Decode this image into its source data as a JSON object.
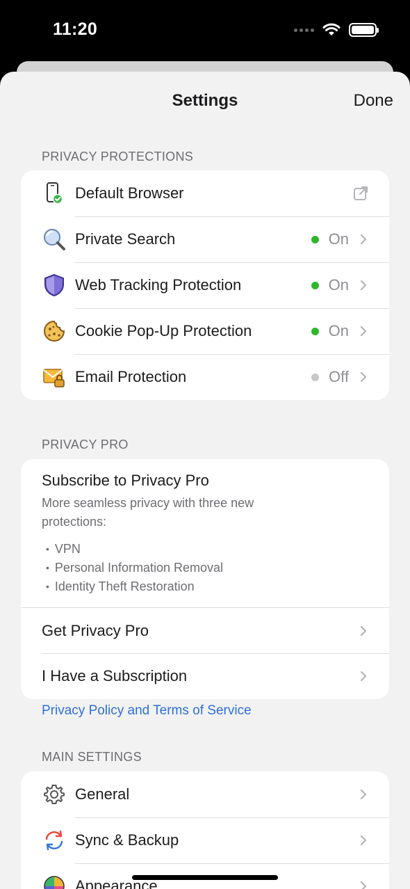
{
  "status_bar": {
    "time": "11:20"
  },
  "nav": {
    "title": "Settings",
    "done": "Done"
  },
  "privacy_protections": {
    "header": "PRIVACY PROTECTIONS",
    "items": [
      {
        "label": "Default Browser",
        "icon": "phone-check-icon"
      },
      {
        "label": "Private Search",
        "status": "On",
        "status_color": "#2fb62c",
        "icon": "magnifier-icon"
      },
      {
        "label": "Web Tracking Protection",
        "status": "On",
        "status_color": "#2fb62c",
        "icon": "shield-icon"
      },
      {
        "label": "Cookie Pop-Up Protection",
        "status": "On",
        "status_color": "#2fb62c",
        "icon": "cookie-icon"
      },
      {
        "label": "Email Protection",
        "status": "Off",
        "status_color": "#c7c7cc",
        "icon": "envelope-lock-icon"
      }
    ]
  },
  "privacy_pro": {
    "header": "PRIVACY PRO",
    "title": "Subscribe to Privacy Pro",
    "description": "More seamless privacy with three new protections:",
    "features": [
      "VPN",
      "Personal Information Removal",
      "Identity Theft Restoration"
    ],
    "get_label": "Get Privacy Pro",
    "have_label": "I Have a Subscription",
    "policy_link": "Privacy Policy and Terms of Service"
  },
  "main_settings": {
    "header": "MAIN SETTINGS",
    "items": [
      {
        "label": "General",
        "icon": "gear-icon"
      },
      {
        "label": "Sync & Backup",
        "icon": "sync-icon"
      },
      {
        "label": "Appearance",
        "icon": "color-wheel-icon"
      }
    ]
  },
  "colors": {
    "accent_link": "#2f6fd6",
    "on": "#2fb62c",
    "off": "#c7c7cc"
  }
}
